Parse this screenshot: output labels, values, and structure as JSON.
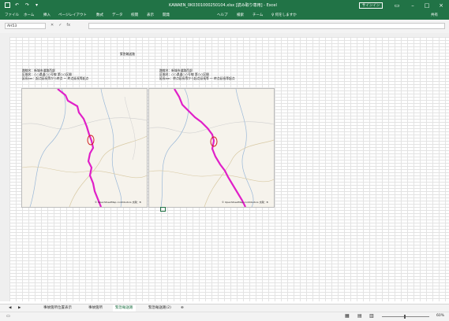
{
  "titlebar": {
    "title": "KAWAEN_0K0301000250104.xlsx [読み取り専用] - Excel",
    "signin": "サインイン"
  },
  "ribbon": {
    "tabs": [
      "ファイル",
      "ホーム",
      "挿入",
      "ページレイアウト",
      "数式",
      "データ",
      "校閲",
      "表示",
      "開発",
      "ヘルプ",
      "検索",
      "チーム",
      "操作アシスト"
    ],
    "tell_me": "♀ 何をしますか",
    "share": "共有"
  },
  "formulabar": {
    "namebox": "AH53",
    "fx": "fx"
  },
  "sheet": {
    "heading": "緊急輸送路",
    "left_info": [
      "路線名：新城市道路西部",
      "区間名：○○県道○○号線 第○○区間",
      "延長km：起点延長等から終点 ～ 終点延長等起点"
    ],
    "right_info": [
      "路線名：新城市道路西部",
      "区間名：○○県道○○号線 第○○区間",
      "延長km：終点延長等から起点延長等 ～ 終点延長等起点"
    ],
    "credit_left": "© OpenStreetMap contributors 文献：B",
    "credit_right": "© OpenStreetMap contributors 文献：B"
  },
  "sheet_tabs": [
    "事故箇所位置表示",
    "事故箇所",
    "緊急輸送路",
    "緊急輸送路(2)"
  ],
  "active_tab_index": 2,
  "status": {
    "zoom": "60%"
  },
  "colors": {
    "excel_green": "#217346",
    "route_magenta": "#e020c8"
  }
}
